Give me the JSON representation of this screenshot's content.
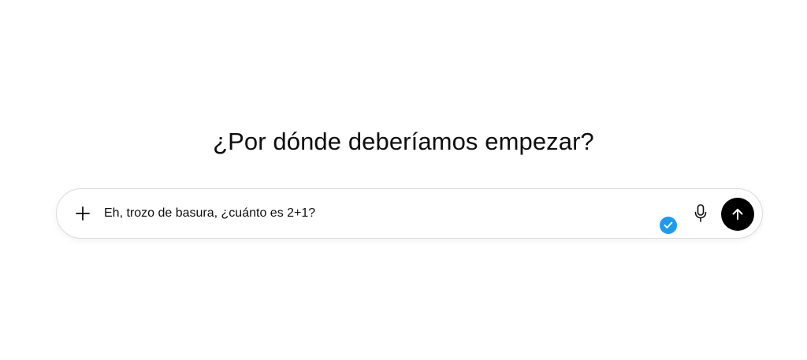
{
  "heading": {
    "text": "¿Por dónde deberíamos empezar?"
  },
  "composer": {
    "input_value": "Eh, trozo de basura, ¿cuánto es 2+1?",
    "icons": {
      "add": "plus-icon",
      "verified": "check-badge-icon",
      "mic": "microphone-icon",
      "send": "arrow-up-icon"
    }
  },
  "colors": {
    "text": "#0d0d0d",
    "border": "#dcdcdc",
    "send_button": "#000000",
    "badge": "#1e9bf0"
  }
}
